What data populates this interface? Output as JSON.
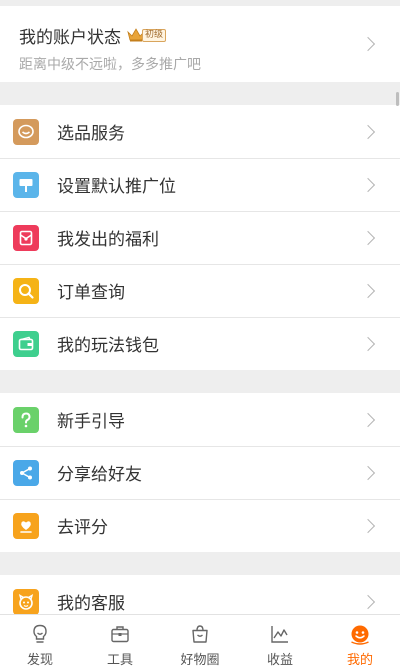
{
  "account": {
    "title": "我的账户状态",
    "level_badge": "初级",
    "subtitle": "距离中级不远啦，多多推广吧"
  },
  "groups": [
    {
      "items": [
        {
          "label": "选品服务",
          "icon": "chat-bubble-icon",
          "color": "#d49a5c"
        },
        {
          "label": "设置默认推广位",
          "icon": "signboard-icon",
          "color": "#5bb5ea"
        },
        {
          "label": "我发出的福利",
          "icon": "red-envelope-icon",
          "color": "#ee3b5b"
        },
        {
          "label": "订单查询",
          "icon": "magnifier-icon",
          "color": "#f5b316"
        },
        {
          "label": "我的玩法钱包",
          "icon": "wallet-icon",
          "color": "#3ecf8e"
        }
      ]
    },
    {
      "items": [
        {
          "label": "新手引导",
          "icon": "question-icon",
          "color": "#6ad16a"
        },
        {
          "label": "分享给好友",
          "icon": "share-icon",
          "color": "#4aa8e8"
        },
        {
          "label": "去评分",
          "icon": "heart-flower-icon",
          "color": "#f7a31d"
        }
      ]
    },
    {
      "items": [
        {
          "label": "我的客服",
          "icon": "service-face-icon",
          "color": "#f7a31d"
        }
      ]
    }
  ],
  "tabbar": {
    "tabs": [
      {
        "label": "发现",
        "icon": "lightbulb-icon"
      },
      {
        "label": "工具",
        "icon": "toolbox-icon"
      },
      {
        "label": "好物圈",
        "icon": "shopping-bag-icon"
      },
      {
        "label": "收益",
        "icon": "line-chart-icon"
      },
      {
        "label": "我的",
        "icon": "profile-face-icon",
        "active": true
      }
    ],
    "active_color": "#ff6a00"
  }
}
